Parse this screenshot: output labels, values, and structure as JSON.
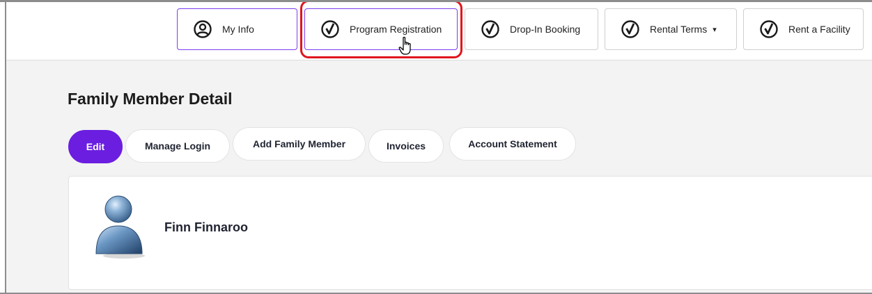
{
  "nav": {
    "items": [
      {
        "label": "My Info",
        "icon": "user-circle-icon"
      },
      {
        "label": "Program Registration",
        "icon": "brand-logo-icon"
      },
      {
        "label": "Drop-In Booking",
        "icon": "brand-logo-icon"
      },
      {
        "label": "Rental Terms",
        "icon": "brand-logo-icon",
        "has_dropdown": true,
        "caret": "▾"
      },
      {
        "label": "Rent a Facility",
        "icon": "brand-logo-icon"
      }
    ]
  },
  "page": {
    "title": "Family Member Detail"
  },
  "tabs": [
    {
      "label": "Edit",
      "active": true
    },
    {
      "label": "Manage Login"
    },
    {
      "label": "Add Family Member"
    },
    {
      "label": "Invoices"
    },
    {
      "label": "Account Statement"
    }
  ],
  "member": {
    "name": "Finn Finnaroo"
  },
  "colors": {
    "accent": "#6b1ee0",
    "highlight": "#e0141e",
    "background": "#f3f3f3"
  }
}
